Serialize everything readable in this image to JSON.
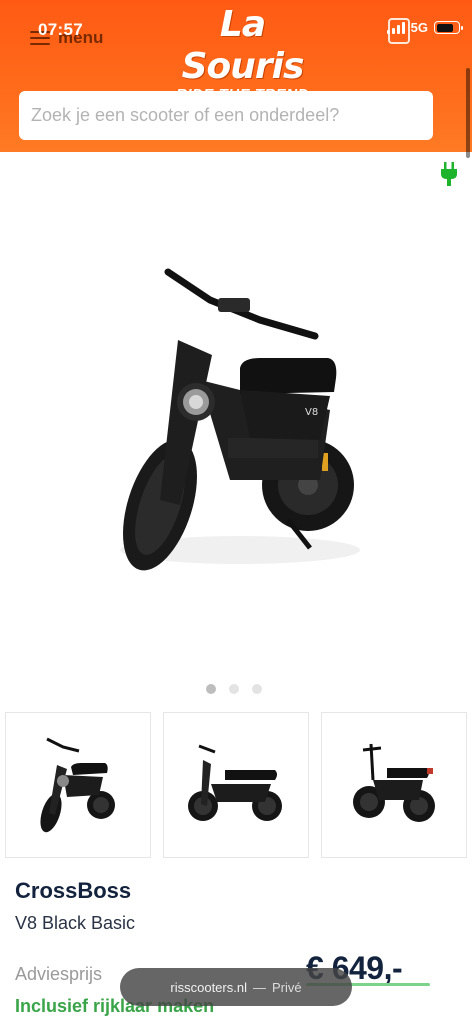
{
  "status_bar": {
    "time": "07:57",
    "network": "5G"
  },
  "header": {
    "menu_label": "menu",
    "logo_title": "La Souris",
    "logo_tagline": "RIDE THE TREND"
  },
  "search": {
    "placeholder": "Zoek je een scooter of een onderdeel?"
  },
  "product": {
    "brand": "CrossBoss",
    "model": "V8 Black Basic",
    "advice_label": "Adviesprijs",
    "price": "€ 649,-",
    "delivery_note": "Inclusief rijklaar maken",
    "gallery_dots": 3,
    "active_dot": 1
  },
  "browser": {
    "url": "risscooters.nl",
    "mode": "Privé"
  },
  "colors": {
    "brand_orange": "#ff5a14",
    "dark_text": "#13233d",
    "green": "#3aa548",
    "plug_green": "#1db32b"
  }
}
